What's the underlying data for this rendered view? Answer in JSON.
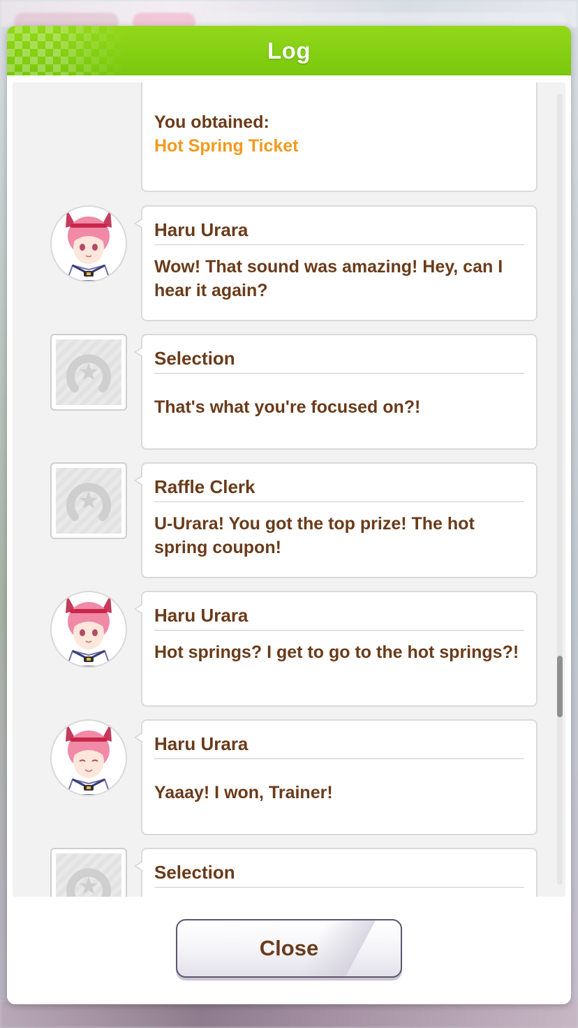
{
  "dialog": {
    "title": "Log",
    "close_label": "Close"
  },
  "log_entries": [
    {
      "type": "reward",
      "lines": [
        "You obtained:"
      ],
      "highlight": "Hot Spring Ticket"
    },
    {
      "type": "dialogue",
      "avatar": "haru-urara-portrait",
      "speaker": "Haru Urara",
      "message": "Wow! That sound was amazing! Hey, can I hear it again?"
    },
    {
      "type": "dialogue",
      "avatar": "horseshoe-placeholder-icon",
      "speaker": "Selection",
      "message": "That's what you're focused on?!"
    },
    {
      "type": "dialogue",
      "avatar": "horseshoe-placeholder-icon",
      "speaker": "Raffle Clerk",
      "message": "U-Urara! You got the top prize! The hot spring coupon!"
    },
    {
      "type": "dialogue",
      "avatar": "haru-urara-portrait",
      "speaker": "Haru Urara",
      "message": "Hot springs? I get to go to the hot springs?!"
    },
    {
      "type": "dialogue",
      "avatar": "haru-urara-portrait",
      "speaker": "Haru Urara",
      "message": "Yaaay! I won, Trainer!"
    },
    {
      "type": "dialogue",
      "avatar": "horseshoe-placeholder-icon",
      "speaker": "Selection",
      "message": ""
    }
  ],
  "colors": {
    "header_green": "#84d014",
    "text_brown": "#6a3b1a",
    "highlight_orange": "#f29a1e"
  }
}
